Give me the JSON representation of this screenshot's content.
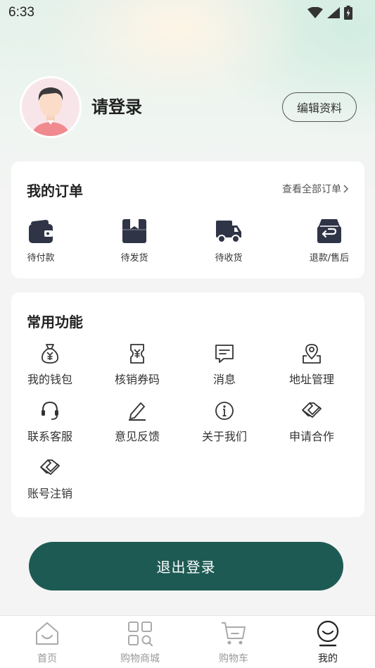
{
  "status_bar": {
    "time": "6:33"
  },
  "profile": {
    "login_label": "请登录",
    "edit_button": "编辑资料"
  },
  "orders": {
    "title": "我的订单",
    "view_all": "查看全部订单",
    "items": [
      {
        "label": "待付款",
        "icon": "wallet-icon"
      },
      {
        "label": "待发货",
        "icon": "package-icon"
      },
      {
        "label": "待收货",
        "icon": "truck-icon"
      },
      {
        "label": "退款/售后",
        "icon": "refund-icon"
      }
    ]
  },
  "functions": {
    "title": "常用功能",
    "items": [
      {
        "label": "我的钱包",
        "icon": "money-bag-icon"
      },
      {
        "label": "核销券码",
        "icon": "coupon-icon"
      },
      {
        "label": "消息",
        "icon": "message-icon"
      },
      {
        "label": "地址管理",
        "icon": "map-pin-icon"
      },
      {
        "label": "联系客服",
        "icon": "headset-icon"
      },
      {
        "label": "意见反馈",
        "icon": "edit-icon"
      },
      {
        "label": "关于我们",
        "icon": "info-icon"
      },
      {
        "label": "申请合作",
        "icon": "handshake-icon"
      },
      {
        "label": "账号注销",
        "icon": "handshake-icon"
      }
    ]
  },
  "logout_button": "退出登录",
  "tabbar": {
    "items": [
      {
        "label": "首页",
        "icon": "home-icon"
      },
      {
        "label": "购物商城",
        "icon": "grid-search-icon"
      },
      {
        "label": "购物车",
        "icon": "cart-icon"
      },
      {
        "label": "我的",
        "icon": "profile-icon"
      }
    ],
    "active_index": 3
  },
  "colors": {
    "primary": "#1e5a54",
    "icon_dark": "#2f3447"
  }
}
